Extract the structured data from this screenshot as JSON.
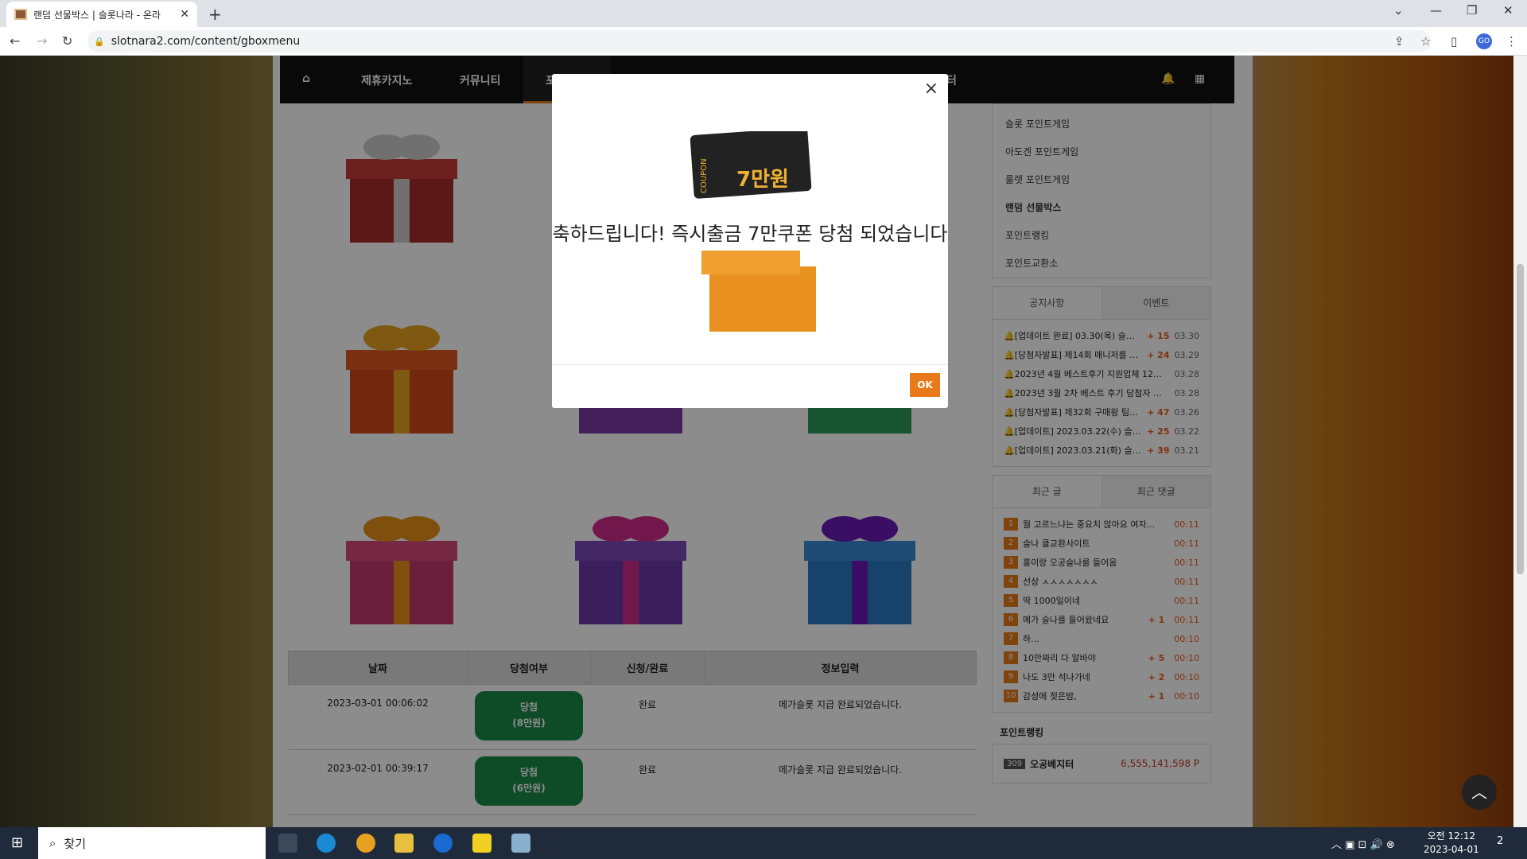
{
  "browser": {
    "tab_title": "랜덤 선물박스 | 슬롯나라 - 온라",
    "url": "slotnara2.com/content/gboxmenu",
    "profile": "GO"
  },
  "nav": {
    "items": [
      "제휴카지노",
      "커뮤니티",
      "포",
      "터"
    ]
  },
  "modal": {
    "message": "축하드립니다! 즉시출금 7만쿠폰 당첨 되었습니다",
    "coupon_text": "7만원",
    "coupon_label": "COUPON",
    "ok_label": "OK",
    "close_label": "×"
  },
  "table": {
    "headers": [
      "날짜",
      "당첨여부",
      "신청/완료",
      "정보입력"
    ],
    "rows": [
      {
        "date": "2023-03-01 00:06:02",
        "result": "당첨",
        "amount": "(8만원)",
        "status": "완료",
        "info": "메가슬롯 지급 완료되었습니다."
      },
      {
        "date": "2023-02-01 00:39:17",
        "result": "당첨",
        "amount": "(6만원)",
        "status": "완료",
        "info": "메가슬롯 지급 완료되었습니다."
      }
    ]
  },
  "sidebar": {
    "menu": [
      "슬롯 포인트게임",
      "아도겐 포인트게임",
      "룰렛 포인트게임",
      "랜덤 선물박스",
      "포인트랭킹",
      "포인트교환소"
    ],
    "notice_tabs": [
      "공지사항",
      "이벤트"
    ],
    "notices": [
      {
        "text": "[업데이트 완료] 03.30(목) 슬롯나...",
        "count": "+ 15",
        "date": "03.30"
      },
      {
        "text": "[당첨자발표] 제14회 매니저를 이...",
        "count": "+ 24",
        "date": "03.29"
      },
      {
        "text": "2023년 4월 베스트후기 지원업체 123...",
        "count": "",
        "date": "03.28"
      },
      {
        "text": "2023년 3월 2차 베스트 후기 당첨자 발...",
        "count": "",
        "date": "03.28"
      },
      {
        "text": "[당첨자발표] 제32회 구매왕 팀룰...",
        "count": "+ 47",
        "date": "03.26"
      },
      {
        "text": "[업데이트] 2023.03.22(수) 슬롯...",
        "count": "+ 25",
        "date": "03.22"
      },
      {
        "text": "[업데이트] 2023.03.21(화) 슬롯...",
        "count": "+ 39",
        "date": "03.21"
      }
    ],
    "recent_tabs": [
      "최근 글",
      "최근 댓글"
    ],
    "recent": [
      {
        "n": "1",
        "text": "뭘 고르느냐는 중요치 않아요 여자...",
        "count": "",
        "time": "00:11"
      },
      {
        "n": "2",
        "text": "슬나 클교환사이트",
        "count": "",
        "time": "00:11"
      },
      {
        "n": "3",
        "text": "홍이랑 오공슬나를 들어옴",
        "count": "",
        "time": "00:11"
      },
      {
        "n": "4",
        "text": "선상 ㅅㅅㅅㅅㅅㅅㅅ",
        "count": "",
        "time": "00:11"
      },
      {
        "n": "5",
        "text": "딱 1000일이네",
        "count": "",
        "time": "00:11"
      },
      {
        "n": "6",
        "text": "메가 슬나를 들어왔네요",
        "count": "+ 1",
        "time": "00:11"
      },
      {
        "n": "7",
        "text": "하...",
        "count": "",
        "time": "00:10"
      },
      {
        "n": "8",
        "text": "10만짜리 다 알바야",
        "count": "+ 5",
        "time": "00:10"
      },
      {
        "n": "9",
        "text": "나도 3만 석나가네",
        "count": "+ 2",
        "time": "00:10"
      },
      {
        "n": "10",
        "text": "감성에 젖은밤,",
        "count": "+ 1",
        "time": "00:10"
      }
    ],
    "ranking_title": "포인트랭킹",
    "ranking": [
      {
        "level": "309",
        "name": "오공베지터",
        "points": "6,555,141,598 P"
      }
    ]
  },
  "taskbar": {
    "search_placeholder": "찾기",
    "time": "오전 12:12",
    "date": "2023-04-01",
    "notif": "2"
  },
  "colors": {
    "accent": "#e87a1a",
    "win_green": "#1a8a4a",
    "nav_bg": "#111111"
  }
}
